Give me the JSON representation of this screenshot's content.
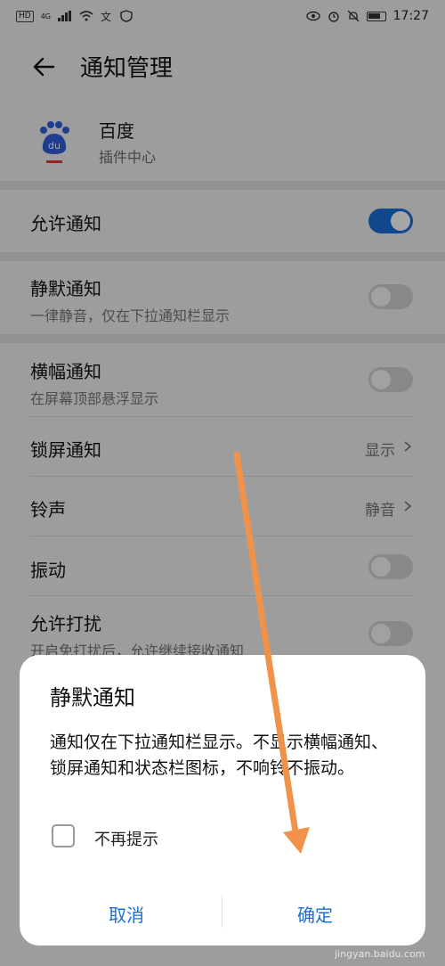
{
  "status_bar": {
    "left_tags": [
      "HD",
      "4G"
    ],
    "time": "17:27"
  },
  "header": {
    "title": "通知管理"
  },
  "app": {
    "name": "百度",
    "subtitle": "插件中心",
    "icon_text": "du"
  },
  "settings": {
    "allow": {
      "label": "允许通知",
      "on": true
    },
    "silent": {
      "label": "静默通知",
      "sub": "一律静音，仅在下拉通知栏显示",
      "on": false
    },
    "banner": {
      "label": "横幅通知",
      "sub": "在屏幕顶部悬浮显示",
      "on": false
    },
    "lockscreen": {
      "label": "锁屏通知",
      "value": "显示"
    },
    "ringtone": {
      "label": "铃声",
      "value": "静音"
    },
    "vibrate": {
      "label": "振动",
      "on": false
    },
    "dnd": {
      "label": "允许打扰",
      "sub": "开启免打扰后，允许继续接收通知",
      "on": false
    }
  },
  "dialog": {
    "title": "静默通知",
    "body": "通知仅在下拉通知栏显示。不显示横幅通知、锁屏通知和状态栏图标，不响铃不振动。",
    "checkbox_label": "不再提示",
    "cancel": "取消",
    "confirm": "确定"
  },
  "colors": {
    "accent": "#1a6fd6",
    "annotation_arrow": "#f0924a"
  }
}
